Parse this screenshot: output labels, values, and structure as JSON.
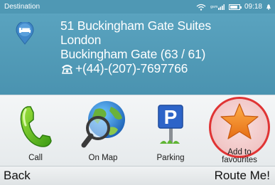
{
  "status_bar": {
    "title": "Destination",
    "clock": "09:18",
    "battery_level": 0.8,
    "icons": [
      "wifi-icon",
      "signal-icon",
      "battery-icon"
    ]
  },
  "destination": {
    "icon": "bed-pin-icon",
    "name": "51 Buckingham Gate Suites",
    "city": "London",
    "street": "Buckingham Gate (63 / 61)",
    "phone": "+(44)-(207)-7697766"
  },
  "actions": [
    {
      "label": "Call",
      "icon": "phone-handset-icon"
    },
    {
      "label": "On Map",
      "icon": "globe-magnifier-icon"
    },
    {
      "label": "Parking",
      "icon": "parking-sign-icon"
    },
    {
      "label_line1": "Add to",
      "label_line2": "favourites",
      "icon": "star-icon"
    }
  ],
  "softkeys": {
    "left": "Back",
    "right": "Route Me!"
  },
  "colors": {
    "header_blue": "#4f98b4",
    "highlight_ring": "#e03434",
    "star_orange": "#f0892a"
  }
}
